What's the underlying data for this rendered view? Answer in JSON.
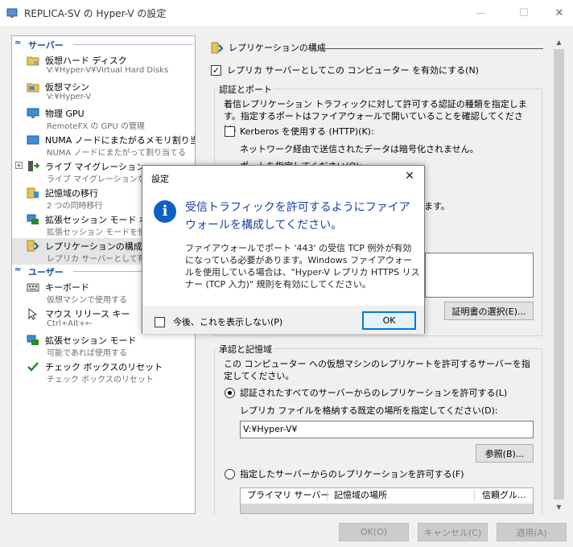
{
  "window": {
    "title": "REPLICA-SV の Hyper-V の設定",
    "minimize": "—",
    "maximize": "☐",
    "close": "✕"
  },
  "sidebar": {
    "server_header": "サーバー",
    "user_header": "ユーザー",
    "server_items": [
      {
        "name": "仮想ハード ディスク",
        "sub": "V:¥Hyper-V¥Virtual Hard Disks",
        "icon": "folder-disk-icon"
      },
      {
        "name": "仮想マシン",
        "sub": "V:¥Hyper-V",
        "icon": "folder-vm-icon"
      },
      {
        "name": "物理 GPU",
        "sub": "RemoteFX の GPU の管理",
        "icon": "monitor-icon"
      },
      {
        "name": "NUMA ノードにまたがるメモリ割り当て",
        "sub": "NUMA ノードにまたがって割り当てる",
        "icon": "numa-icon"
      },
      {
        "name": "ライブ マイグレーション",
        "sub": "ライブ マイグレーションなし",
        "icon": "live-migration-icon",
        "expander": "+"
      },
      {
        "name": "記憶域の移行",
        "sub": "2 つの同時移行",
        "icon": "storage-migration-icon"
      },
      {
        "name": "拡張セッション モード ポリシー",
        "sub": "拡張セッション モードを使用",
        "icon": "enhanced-session-icon"
      },
      {
        "name": "レプリケーションの構成",
        "sub": "レプリカ サーバーとして有効",
        "icon": "replication-icon"
      }
    ],
    "user_items": [
      {
        "name": "キーボード",
        "sub": "仮想マシンで使用する",
        "icon": "keyboard-icon"
      },
      {
        "name": "マウス リリース キー",
        "sub": "Ctrl+Alt+←",
        "icon": "mouse-icon"
      },
      {
        "name": "拡張セッション モード",
        "sub": "可能であれば使用する",
        "icon": "enhanced-session-icon"
      },
      {
        "name": "チェック ボックスのリセット",
        "sub": "チェック ボックスのリセット",
        "icon": "checkbox-reset-icon"
      }
    ]
  },
  "panel": {
    "title": "レプリケーションの構成",
    "enable_label": "レプリカ サーバーとしてこの コンピューター を有効にする(N)",
    "auth_group": "認証とポート",
    "auth_desc": "着信レプリケーション トラフィックに対して許可する認証の種類を指定します。指定するポートはファイアウォールで開いていることを確認してください。",
    "kerberos_label": "Kerberos を使用する (HTTP)(K):",
    "kerberos_note": "ネットワーク経由で送信されたデータは暗号化されません。",
    "partial_text_1": "ポートを指定してください(O):",
    "partial_text_2": "ます。",
    "cert_button": "証明書の選択(E)...",
    "approval_group": "承認と記憶域",
    "approval_desc": "この コンピューター への仮想マシンのレプリケートを許可するサーバーを指定してください。",
    "radio_all": "認証されたすべてのサーバーからのレプリケーションを許可する(L)",
    "default_location_label": "レプリカ ファイルを格納する既定の場所を指定してください(D):",
    "default_location_value": "V:¥Hyper-V¥",
    "browse_button": "参照(B)...",
    "radio_specified": "指定したサーバーからのレプリケーションを許可する(F)",
    "table_headers": [
      "プライマリ サーバー",
      "記憶域の場所",
      "信頼グル..."
    ]
  },
  "dialog": {
    "title": "設定",
    "close": "✕",
    "main_instruction": "受信トラフィックを許可するようにファイアウォールを構成してください。",
    "content": "ファイアウォールでポート '443' の受信 TCP 例外が有効になっている必要があります。Windows ファイアウォールを使用している場合は、\"Hyper-V レプリカ HTTPS リスナー (TCP 入力)\" 規則を有効にしてください。",
    "dont_show_label": "今後、これを表示しない(P)",
    "ok_label": "OK"
  },
  "footer": {
    "ok_label": "OK(O)",
    "cancel_label": "キャンセル(C)",
    "apply_label": "適用(A)"
  },
  "colors": {
    "header_blue": "#1e4e9c",
    "dialog_instruction": "#1c3fa8",
    "info_icon": "#0e60c7",
    "ok_border": "#0078d7"
  }
}
